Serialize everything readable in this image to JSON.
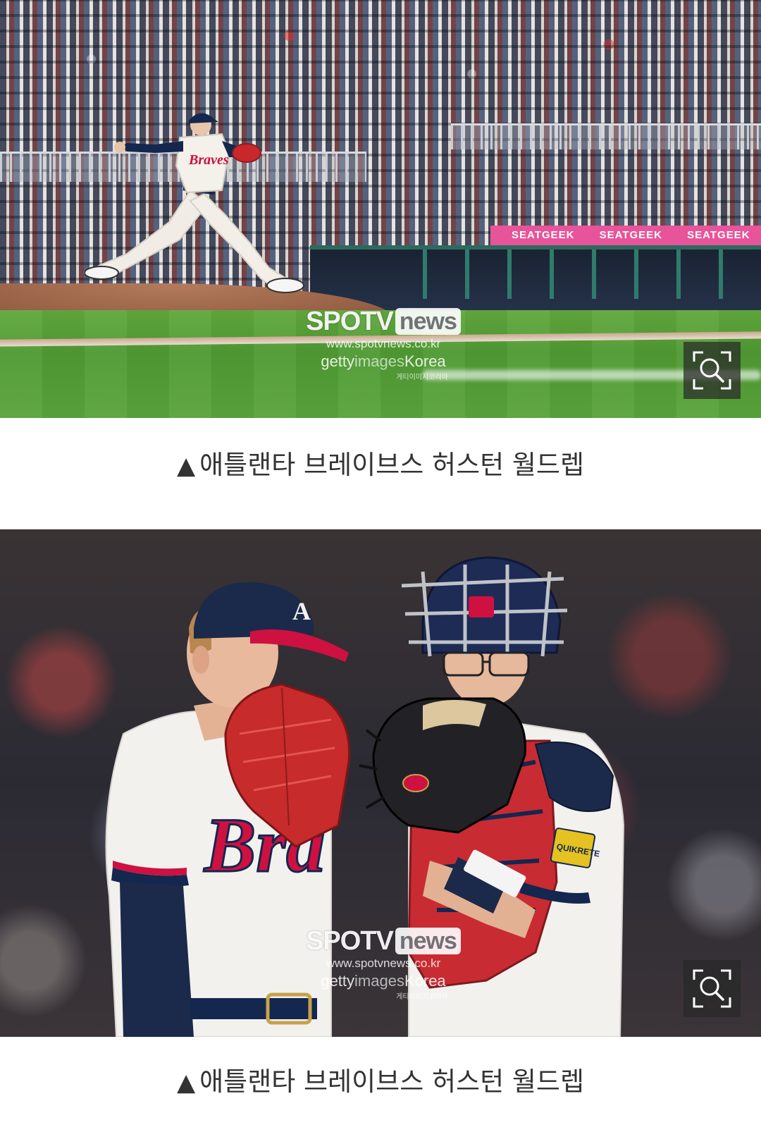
{
  "photos": [
    {
      "watermark": {
        "brand_spotv": "SPOTV",
        "brand_news": "news",
        "url": "www.spotvnews.co.kr",
        "getty_prefix": "getty",
        "getty_middle": "images",
        "getty_suffix": "Korea",
        "getty_korean": "게티이미지코리아"
      },
      "banner_texts": [
        "SEATGEEK",
        "SEATGEEK",
        "SEATGEEK"
      ],
      "zoom_icon": "zoom-search-icon",
      "caption": {
        "marker": "▲",
        "text": "애틀랜타 브레이브스 허스턴 월드렙"
      }
    },
    {
      "watermark": {
        "brand_spotv": "SPOTV",
        "brand_news": "news",
        "url": "www.spotvnews.co.kr",
        "getty_prefix": "getty",
        "getty_middle": "images",
        "getty_suffix": "Korea",
        "getty_korean": "게티이미지코리아"
      },
      "jersey_text": "Bra",
      "patch_text": "QUIKRETE",
      "zoom_icon": "zoom-search-icon",
      "caption": {
        "marker": "▲",
        "text": "애틀랜타 브레이브스 허스턴 월드렙"
      }
    }
  ],
  "colors": {
    "caption_text": "#333333",
    "background": "#ffffff",
    "zoom_button_bg": "#282828",
    "braves_navy": "#13274f",
    "braves_red": "#ce1141",
    "banner_pink": "#e8549a"
  }
}
